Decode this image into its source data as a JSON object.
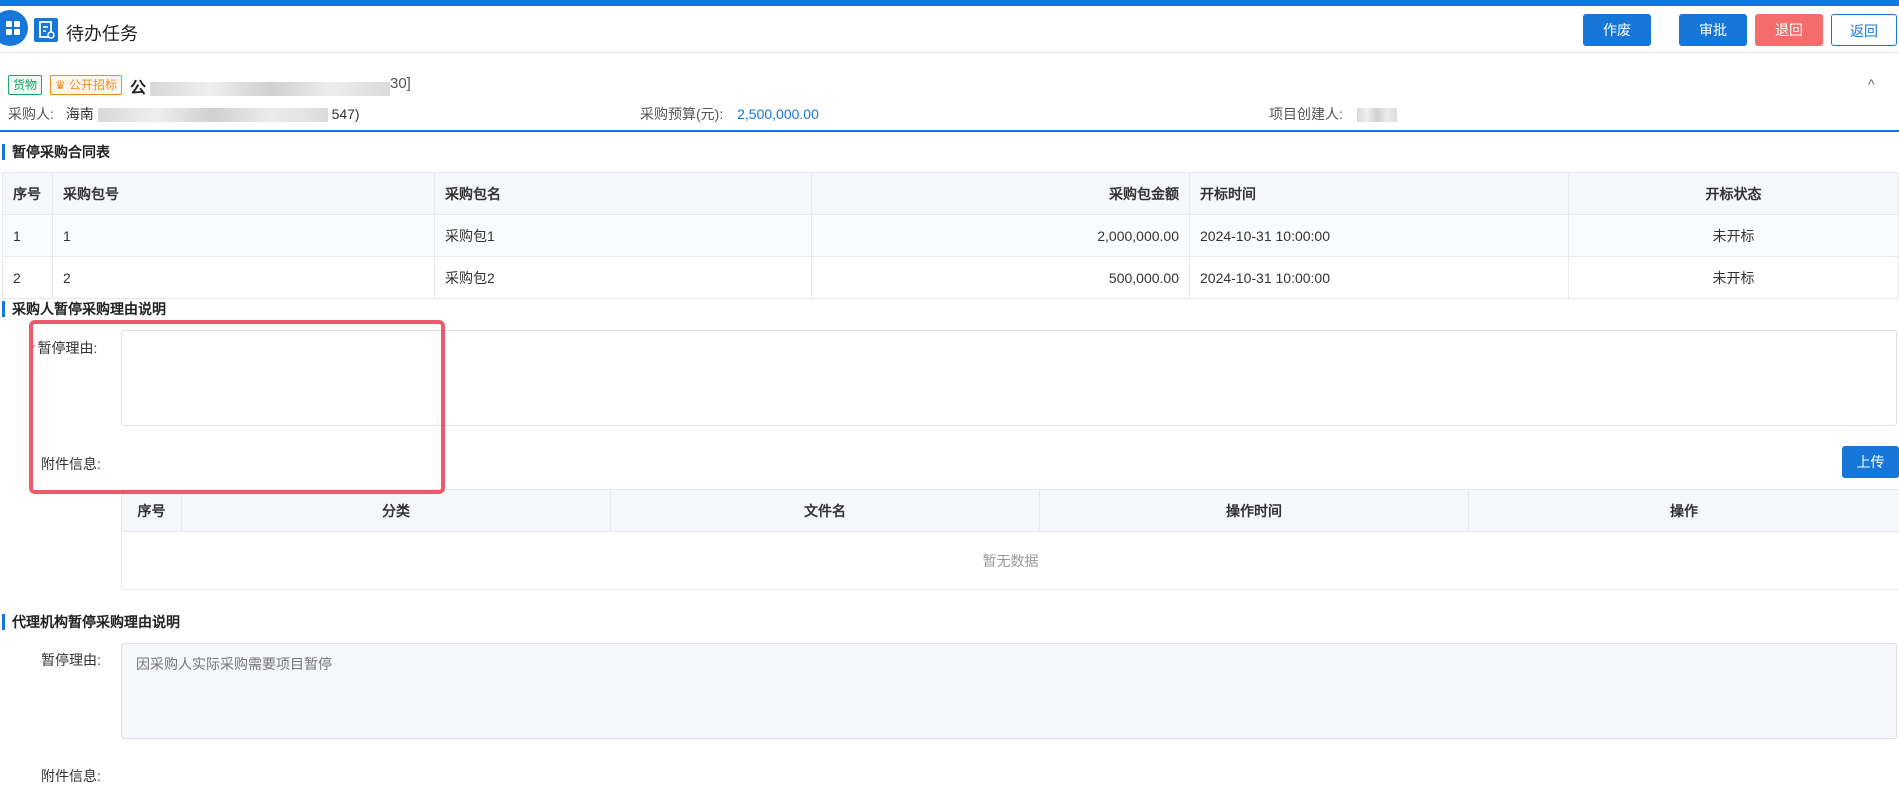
{
  "header": {
    "title": "待办任务",
    "buttons": {
      "void": "作废",
      "approve": "审批",
      "return_back": "退回",
      "back": "返回"
    }
  },
  "project": {
    "tags": [
      "货物",
      "公开招标"
    ],
    "name_prefix": "公",
    "name_suffix": "30]",
    "purchaser_label": "采购人:",
    "purchaser_value_start": "海南",
    "purchaser_value_end": "547)",
    "budget_label": "采购预算(元):",
    "budget_value": "2,500,000.00",
    "creator_label": "项目创建人:",
    "collapse_icon": "^"
  },
  "contract_section": {
    "title": "暂停采购合同表",
    "columns": [
      "序号",
      "采购包号",
      "采购包名",
      "采购包金额",
      "开标时间",
      "开标状态"
    ],
    "rows": [
      [
        "1",
        "1",
        "采购包1",
        "2,000,000.00",
        "2024-10-31 10:00:00",
        "未开标"
      ],
      [
        "2",
        "2",
        "采购包2",
        "500,000.00",
        "2024-10-31 10:00:00",
        "未开标"
      ]
    ]
  },
  "purchaser_reason": {
    "title": "采购人暂停采购理由说明",
    "reason_label": "暂停理由:",
    "reason_value": "",
    "attachment_label": "附件信息:",
    "upload_label": "上传",
    "attachment_columns": [
      "序号",
      "分类",
      "文件名",
      "操作时间",
      "操作"
    ],
    "empty_text": "暂无数据"
  },
  "agency_reason": {
    "title": "代理机构暂停采购理由说明",
    "reason_label": "暂停理由:",
    "reason_placeholder": "因采购人实际采购需要项目暂停",
    "attachment_label": "附件信息:"
  },
  "colors": {
    "primary": "#1677d8",
    "danger": "#f56c6c",
    "highlight": "#f0596b"
  }
}
